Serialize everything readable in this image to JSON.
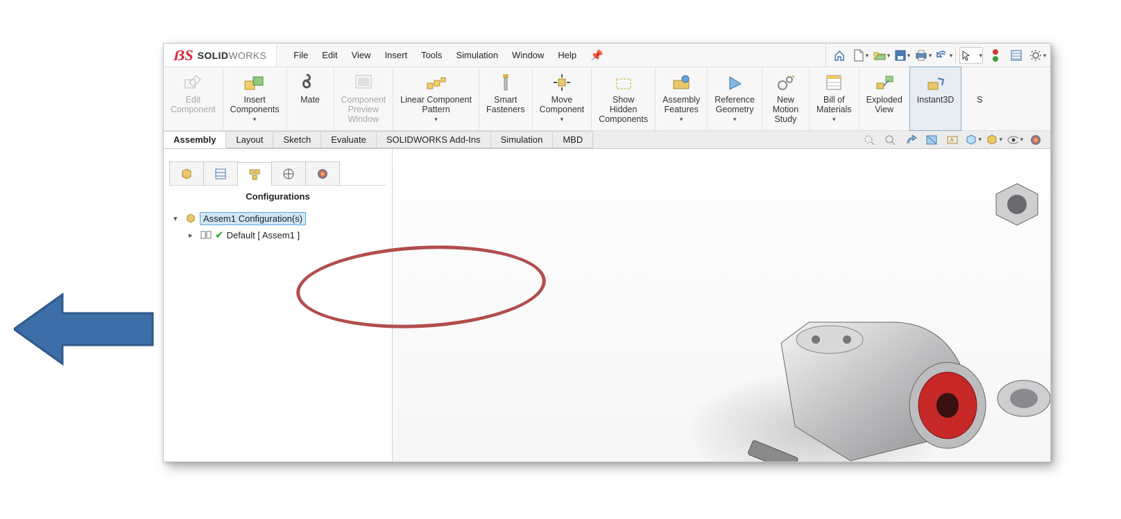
{
  "app": {
    "brand_solid": "SOLID",
    "brand_works": "WORKS"
  },
  "menus": {
    "file": "File",
    "edit": "Edit",
    "view": "View",
    "insert": "Insert",
    "tools": "Tools",
    "simulation": "Simulation",
    "window": "Window",
    "help": "Help"
  },
  "ribbon": {
    "edit_component": "Edit\nComponent",
    "insert_components": "Insert\nComponents",
    "mate": "Mate",
    "component_preview": "Component\nPreview\nWindow",
    "linear_pattern": "Linear Component\nPattern",
    "smart_fasteners": "Smart\nFasteners",
    "move_component": "Move\nComponent",
    "show_hidden": "Show\nHidden\nComponents",
    "assembly_features": "Assembly\nFeatures",
    "reference_geometry": "Reference\nGeometry",
    "new_motion_study": "New\nMotion\nStudy",
    "bom": "Bill of\nMaterials",
    "exploded_view": "Exploded\nView",
    "instant3d": "Instant3D",
    "partial_s": "S"
  },
  "tabs": {
    "assembly": "Assembly",
    "layout": "Layout",
    "sketch": "Sketch",
    "evaluate": "Evaluate",
    "addins": "SOLIDWORKS Add-Ins",
    "simulation": "Simulation",
    "mbd": "MBD"
  },
  "panel": {
    "title": "Configurations",
    "root_label": "Assem1 Configuration(s)",
    "child_label": "Default [ Assem1 ]"
  }
}
